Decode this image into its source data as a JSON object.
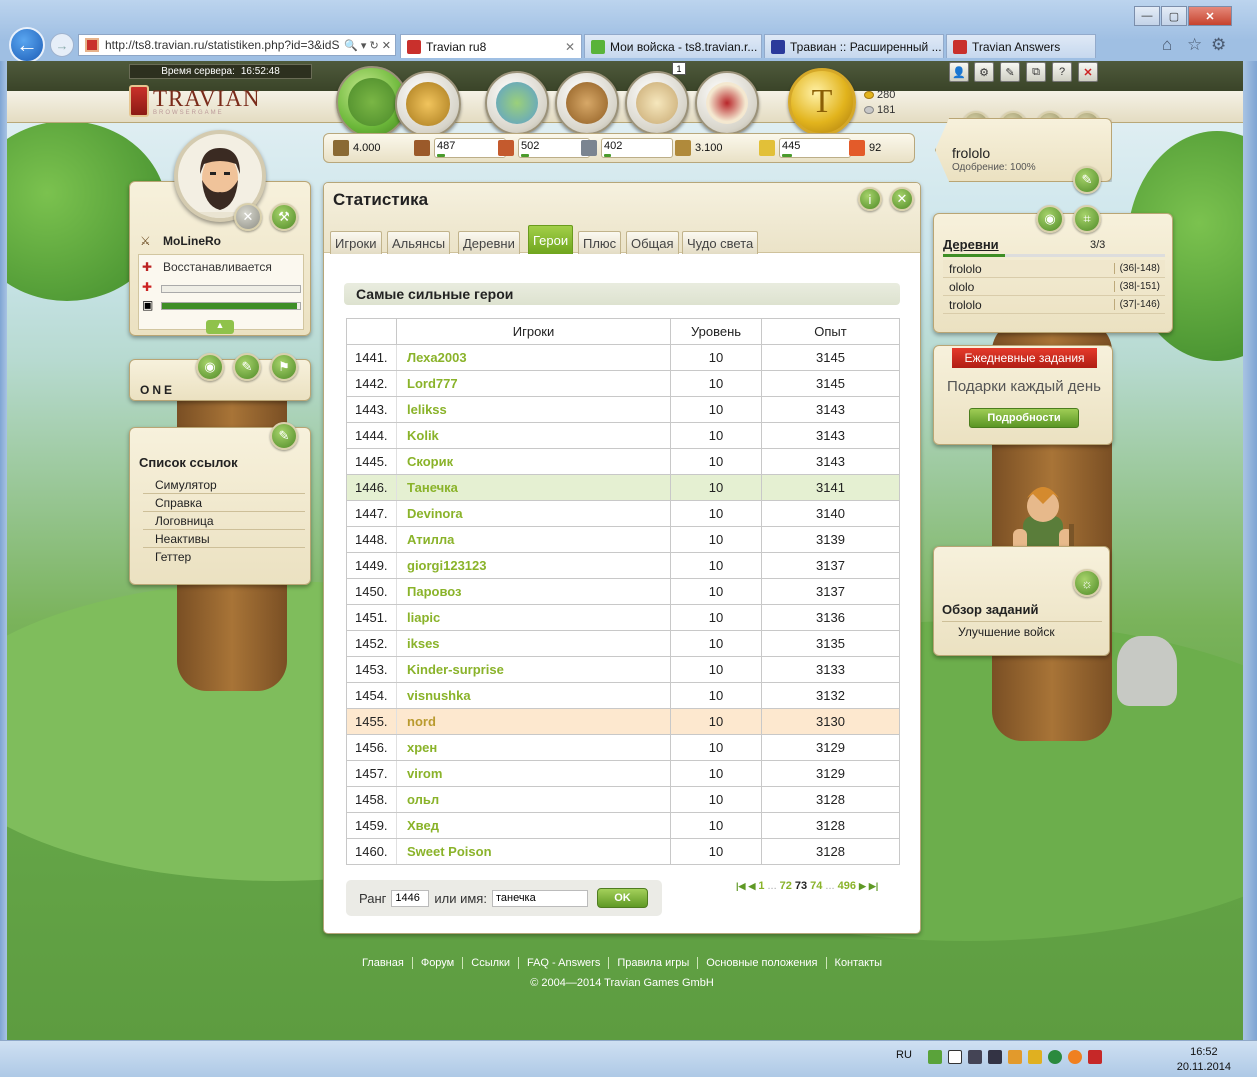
{
  "browser": {
    "url": "http://ts8.travian.ru/statistiken.php?id=3&idS",
    "tabs": [
      {
        "label": "Travian ru8",
        "active": true
      },
      {
        "label": "Мои войска - ts8.travian.r..."
      },
      {
        "label": "Травиан :: Расширенный ..."
      },
      {
        "label": "Travian Answers"
      }
    ]
  },
  "header": {
    "server_time_label": "Время сервера:",
    "server_time": "16:52:48",
    "logo_name": "TRAVIAN",
    "logo_sub": "BROWSERGAME",
    "gold": "280",
    "silver": "181",
    "reports_badge": "1"
  },
  "resources": {
    "warehouse": "4.000",
    "wood": "487",
    "clay": "502",
    "iron": "402",
    "granary": "3.100",
    "crop": "445",
    "crop_balance": "92"
  },
  "hero": {
    "name": "MoLineRo",
    "status": "Восстанавливается",
    "health_fraction": 0.0,
    "experience_fraction": 0.98
  },
  "alliance": {
    "name": "ONE"
  },
  "links": {
    "title": "Список ссылок",
    "items": [
      "Симулятор",
      "Справка",
      "Логовница",
      "Неактивы",
      "Геттер"
    ]
  },
  "stats": {
    "title": "Статистика",
    "tabs": [
      "Игроки",
      "Альянсы",
      "Деревни",
      "Герои",
      "Плюс",
      "Общая",
      "Чудо света"
    ],
    "active_tab": "Герои",
    "subtitle": "Самые сильные герои",
    "columns": {
      "players": "Игроки",
      "level": "Уровень",
      "exp": "Опыт"
    },
    "rows": [
      {
        "rank": "1441.",
        "name": "Леха2003",
        "level": "10",
        "exp": "3145"
      },
      {
        "rank": "1442.",
        "name": "Lord777",
        "level": "10",
        "exp": "3145"
      },
      {
        "rank": "1443.",
        "name": "lelikss",
        "level": "10",
        "exp": "3143"
      },
      {
        "rank": "1444.",
        "name": "Kolik",
        "level": "10",
        "exp": "3143"
      },
      {
        "rank": "1445.",
        "name": "Скорик",
        "level": "10",
        "exp": "3143"
      },
      {
        "rank": "1446.",
        "name": "Танечка",
        "level": "10",
        "exp": "3141"
      },
      {
        "rank": "1447.",
        "name": "Devinora",
        "level": "10",
        "exp": "3140"
      },
      {
        "rank": "1448.",
        "name": "Атилла",
        "level": "10",
        "exp": "3139"
      },
      {
        "rank": "1449.",
        "name": "giorgi123123",
        "level": "10",
        "exp": "3137"
      },
      {
        "rank": "1450.",
        "name": "Паровоз",
        "level": "10",
        "exp": "3137"
      },
      {
        "rank": "1451.",
        "name": "liapic",
        "level": "10",
        "exp": "3136"
      },
      {
        "rank": "1452.",
        "name": "ikses",
        "level": "10",
        "exp": "3135"
      },
      {
        "rank": "1453.",
        "name": "Kinder-surprise",
        "level": "10",
        "exp": "3133"
      },
      {
        "rank": "1454.",
        "name": "visnushka",
        "level": "10",
        "exp": "3132"
      },
      {
        "rank": "1455.",
        "name": "nord",
        "level": "10",
        "exp": "3130"
      },
      {
        "rank": "1456.",
        "name": "хрен",
        "level": "10",
        "exp": "3129"
      },
      {
        "rank": "1457.",
        "name": "virom",
        "level": "10",
        "exp": "3129"
      },
      {
        "rank": "1458.",
        "name": "ольл",
        "level": "10",
        "exp": "3128"
      },
      {
        "rank": "1459.",
        "name": "Хвед",
        "level": "10",
        "exp": "3128"
      },
      {
        "rank": "1460.",
        "name": "Sweet Poison",
        "level": "10",
        "exp": "3128"
      }
    ],
    "highlight_index": 5,
    "own_index": 14,
    "search": {
      "rank_label": "Ранг",
      "rank_value": "1446",
      "name_label": "или имя:",
      "name_value": "танечка",
      "ok_label": "OK"
    },
    "pager": {
      "first": "1",
      "dots1": "...",
      "p72": "72",
      "current": "73",
      "p74": "74",
      "dots2": "...",
      "last": "496"
    }
  },
  "player": {
    "name": "frololo",
    "approval": "Одобрение: 100%"
  },
  "villages": {
    "title": "Деревни",
    "count": "3/3",
    "items": [
      {
        "name": "frololo",
        "coords": "(36|-148)"
      },
      {
        "name": "ololo",
        "coords": "(38|-151)"
      },
      {
        "name": "trololo",
        "coords": "(37|-146)"
      }
    ]
  },
  "daily": {
    "ribbon": "Ежедневные задания",
    "text": "Подарки каждый день",
    "button": "Подробности"
  },
  "quests": {
    "title": "Обзор заданий",
    "item": "Улучшение войск"
  },
  "footer": {
    "links": [
      "Главная",
      "Форум",
      "Ссылки",
      "FAQ - Answers",
      "Правила игры",
      "Основные положения",
      "Контакты"
    ],
    "copyright": "© 2004—2014 Travian Games GmbH"
  },
  "taskbar": {
    "lang": "RU",
    "time": "16:52",
    "date": "20.11.2014"
  },
  "colors": {
    "link_green": "#8ab32a",
    "tab_active": "#86bb2e",
    "highlight_row": "#e5f0d2",
    "own_row": "#fde8cf"
  }
}
